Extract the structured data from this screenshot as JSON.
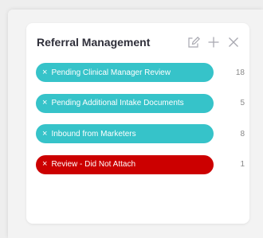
{
  "widget": {
    "title": "Referral Management",
    "actions": [
      {
        "icon": "edit-icon"
      },
      {
        "icon": "plus-icon"
      },
      {
        "icon": "close-icon"
      }
    ]
  },
  "colors": {
    "teal": "#36c3c9",
    "red": "#cc0000",
    "title": "#2f2f3a",
    "count": "#888888",
    "icon": "#a8a8b0"
  },
  "filters": [
    {
      "label": "Pending Clinical Manager Review",
      "count": "18",
      "color": "#36c3c9",
      "remove_icon": "×"
    },
    {
      "label": "Pending Additional Intake Documents",
      "count": "5",
      "color": "#36c3c9",
      "remove_icon": "×"
    },
    {
      "label": "Inbound from Marketers",
      "count": "8",
      "color": "#36c3c9",
      "remove_icon": "×"
    },
    {
      "label": "Review - Did Not Attach",
      "count": "1",
      "color": "#cc0000",
      "remove_icon": "×"
    }
  ]
}
